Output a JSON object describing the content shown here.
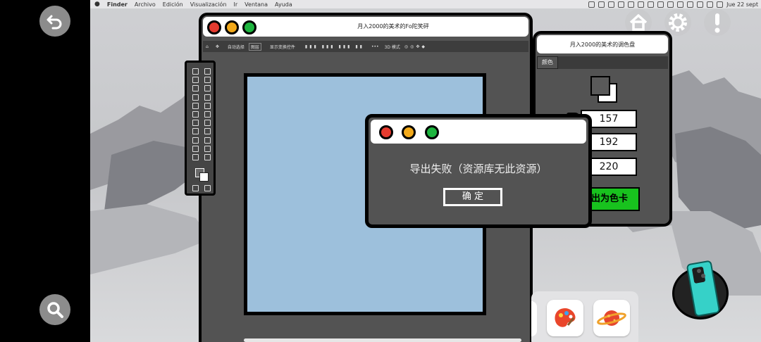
{
  "menubar": {
    "items": [
      "Finder",
      "Archivo",
      "Edición",
      "Visualización",
      "Ir",
      "Ventana",
      "Ayuda"
    ],
    "time": "Jue 22 sept"
  },
  "icons": {
    "back": "back-arrow-icon",
    "search": "search-icon",
    "home": "home-icon",
    "settings": "gear-icon",
    "alert": "exclamation-icon"
  },
  "editor": {
    "title": "月入2000的美术的Fo陀笑砰",
    "toolbar": {
      "auto_select": "自动选择",
      "layer": "图层",
      "show_transform": "显示变换控件",
      "mode": "3D 模式"
    }
  },
  "palette": {
    "title": "月入2000的美术的调色盘",
    "tab": "颜色",
    "r": "157",
    "g": "192",
    "b": "220",
    "export_label": "出为色卡"
  },
  "dialog": {
    "message": "导出失败（资源库无此资源）",
    "ok_label": "确 定"
  },
  "colors": {
    "canvas": "#9dc0dc",
    "window_body": "#535353",
    "export_green": "#18c21e"
  }
}
